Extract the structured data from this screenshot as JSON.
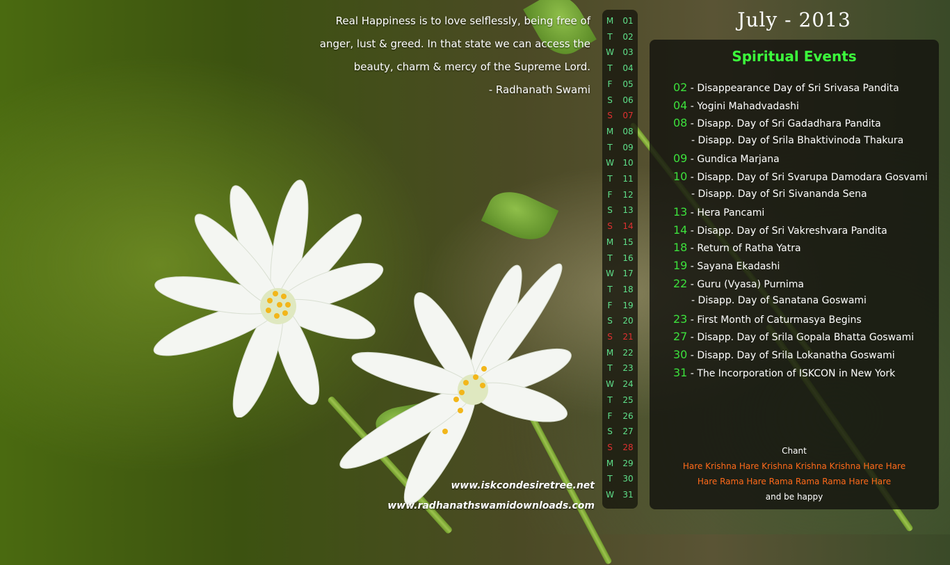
{
  "quote": {
    "lines": [
      "Real Happiness is to love selflessly, being free of",
      "anger, lust & greed. In that state we can access the",
      "beauty, charm & mercy of the Supreme Lord.",
      "- Radhanath Swami"
    ]
  },
  "calendar": {
    "days": [
      {
        "dow": "M",
        "num": "01"
      },
      {
        "dow": "T",
        "num": "02"
      },
      {
        "dow": "W",
        "num": "03"
      },
      {
        "dow": "T",
        "num": "04"
      },
      {
        "dow": "F",
        "num": "05"
      },
      {
        "dow": "S",
        "num": "06"
      },
      {
        "dow": "S",
        "num": "07",
        "sunday": true
      },
      {
        "dow": "M",
        "num": "08"
      },
      {
        "dow": "T",
        "num": "09"
      },
      {
        "dow": "W",
        "num": "10"
      },
      {
        "dow": "T",
        "num": "11"
      },
      {
        "dow": "F",
        "num": "12"
      },
      {
        "dow": "S",
        "num": "13"
      },
      {
        "dow": "S",
        "num": "14",
        "sunday": true
      },
      {
        "dow": "M",
        "num": "15"
      },
      {
        "dow": "T",
        "num": "16"
      },
      {
        "dow": "W",
        "num": "17"
      },
      {
        "dow": "T",
        "num": "18"
      },
      {
        "dow": "F",
        "num": "19"
      },
      {
        "dow": "S",
        "num": "20"
      },
      {
        "dow": "S",
        "num": "21",
        "sunday": true
      },
      {
        "dow": "M",
        "num": "22"
      },
      {
        "dow": "T",
        "num": "23"
      },
      {
        "dow": "W",
        "num": "24"
      },
      {
        "dow": "T",
        "num": "25"
      },
      {
        "dow": "F",
        "num": "26"
      },
      {
        "dow": "S",
        "num": "27"
      },
      {
        "dow": "S",
        "num": "28",
        "sunday": true
      },
      {
        "dow": "M",
        "num": "29"
      },
      {
        "dow": "T",
        "num": "30"
      },
      {
        "dow": "W",
        "num": "31"
      }
    ]
  },
  "month_title": "July - 2013",
  "panel": {
    "title": "Spiritual Events",
    "events": [
      {
        "date": "02",
        "text": "Disappearance Day of Sri Srivasa Pandita"
      },
      {
        "date": "04",
        "text": "Yogini Mahadvadashi"
      },
      {
        "date": "08",
        "text": "Disapp. Day of Sri Gadadhara Pandita"
      },
      {
        "date": "",
        "text": "Disapp. Day of Srila Bhaktivinoda Thakura"
      },
      {
        "date": "09",
        "text": "Gundica Marjana"
      },
      {
        "date": "10",
        "text": "Disapp. Day of Sri Svarupa Damodara Gosvami"
      },
      {
        "date": "",
        "text": "Disapp. Day of Sri Sivananda Sena"
      },
      {
        "date": "13",
        "text": "Hera Pancami"
      },
      {
        "date": "14",
        "text": "Disapp. Day of Sri Vakreshvara Pandita"
      },
      {
        "date": "18",
        "text": "Return of Ratha Yatra"
      },
      {
        "date": "19",
        "text": "Sayana Ekadashi"
      },
      {
        "date": "22",
        "text": "Guru (Vyasa) Purnima"
      },
      {
        "date": "",
        "text": "Disapp. Day of Sanatana Goswami"
      },
      {
        "date": "23",
        "text": "First Month of Caturmasya Begins"
      },
      {
        "date": "27",
        "text": "Disapp. Day of Srila Gopala Bhatta Goswami"
      },
      {
        "date": "30",
        "text": "Disapp. Day of Srila Lokanatha Goswami"
      },
      {
        "date": "31",
        "text": "The Incorporation of ISKCON in New York"
      }
    ],
    "chant": {
      "heading": "Chant",
      "line1": "Hare Krishna Hare Krishna Krishna Krishna Hare Hare",
      "line2": "Hare Rama Hare Rama Rama Rama Hare Hare",
      "footer": "and be happy"
    }
  },
  "sites": {
    "site1": "www.iskcondesiretree.net",
    "site2": "www.radhanathswamidownloads.com"
  },
  "colors": {
    "accent_green": "#3ce03c",
    "sunday_red": "#e03030",
    "chant_orange": "#ff6a1a"
  }
}
